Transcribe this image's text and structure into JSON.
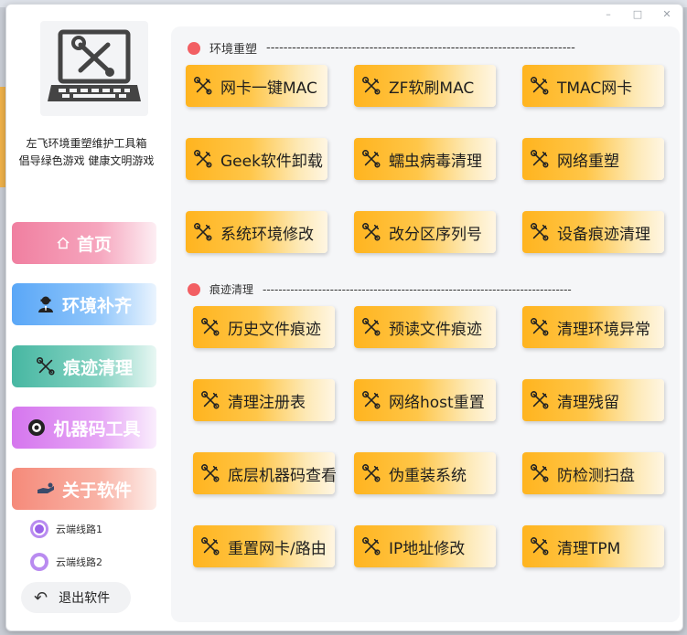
{
  "sidebar": {
    "brand_line1": "左飞环境重塑维护工具箱",
    "brand_line2": "倡导绿色游戏  健康文明游戏",
    "nav": [
      {
        "label": "首页",
        "icon": "home-icon"
      },
      {
        "label": "环境补齐",
        "icon": "user-agent-icon"
      },
      {
        "label": "痕迹清理",
        "icon": "tools-icon"
      },
      {
        "label": "机器码工具",
        "icon": "chip-icon"
      },
      {
        "label": "关于软件",
        "icon": "hand-icon"
      }
    ],
    "radios": [
      {
        "label": "云端线路1",
        "selected": true
      },
      {
        "label": "云端线路2",
        "selected": false
      }
    ],
    "exit_label": "退出软件"
  },
  "sections": {
    "env_reshape": {
      "title": "环境重塑",
      "buttons": [
        "网卡一键MAC",
        "ZF软刷MAC",
        "TMAC网卡",
        "Geek软件卸载",
        "蠕虫病毒清理",
        "网络重塑",
        "系统环境修改",
        "改分区序列号",
        "设备痕迹清理"
      ]
    },
    "trace_clean": {
      "title": "痕迹清理",
      "buttons": [
        "历史文件痕迹",
        "预读文件痕迹",
        "清理环境异常",
        "清理注册表",
        "网络host重置",
        "清理残留",
        "底层机器码查看",
        "伪重装系统",
        "防检测扫盘",
        "重置网卡/路由",
        "IP地址修改",
        "清理TPM"
      ]
    }
  },
  "colors": {
    "accent_button": "#ffb41f",
    "section_bullet": "#f25f63",
    "radio": "#9b63e8"
  }
}
